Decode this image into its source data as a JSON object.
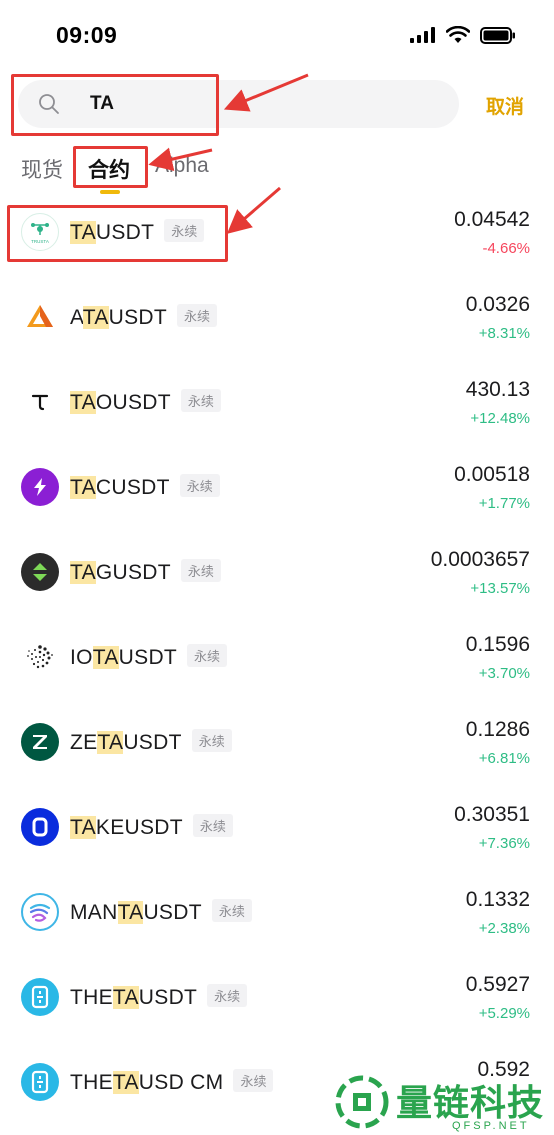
{
  "status_bar": {
    "time": "09:09"
  },
  "search": {
    "value": "TA",
    "cancel_label": "取消"
  },
  "tabs": [
    {
      "label": "现货",
      "active": false
    },
    {
      "label": "合约",
      "active": true
    },
    {
      "label": "Alpha",
      "active": false
    }
  ],
  "badge_label": "永续",
  "rows": [
    {
      "prefix": "",
      "highlight": "TA",
      "suffix": "USDT",
      "price": "0.04542",
      "change": "-4.66%",
      "direction": "down",
      "icon": "trusta-logo-icon"
    },
    {
      "prefix": "A",
      "highlight": "TA",
      "suffix": "USDT",
      "price": "0.0326",
      "change": "+8.31%",
      "direction": "up",
      "icon": "automata-logo-icon"
    },
    {
      "prefix": "",
      "highlight": "TA",
      "suffix": "OUSDT",
      "price": "430.13",
      "change": "+12.48%",
      "direction": "up",
      "icon": "bittensor-logo-icon"
    },
    {
      "prefix": "",
      "highlight": "TA",
      "suffix": "CUSDT",
      "price": "0.00518",
      "change": "+1.77%",
      "direction": "up",
      "icon": "tac-logo-icon"
    },
    {
      "prefix": "",
      "highlight": "TA",
      "suffix": "GUSDT",
      "price": "0.0003657",
      "change": "+13.57%",
      "direction": "up",
      "icon": "tagger-logo-icon"
    },
    {
      "prefix": "IO",
      "highlight": "TA",
      "suffix": "USDT",
      "price": "0.1596",
      "change": "+3.70%",
      "direction": "up",
      "icon": "iota-logo-icon"
    },
    {
      "prefix": "ZE",
      "highlight": "TA",
      "suffix": "USDT",
      "price": "0.1286",
      "change": "+6.81%",
      "direction": "up",
      "icon": "zetachain-logo-icon"
    },
    {
      "prefix": "",
      "highlight": "TA",
      "suffix": "KEUSDT",
      "price": "0.30351",
      "change": "+7.36%",
      "direction": "up",
      "icon": "take-logo-icon"
    },
    {
      "prefix": "MAN",
      "highlight": "TA",
      "suffix": "USDT",
      "price": "0.1332",
      "change": "+2.38%",
      "direction": "up",
      "icon": "manta-logo-icon"
    },
    {
      "prefix": "THE",
      "highlight": "TA",
      "suffix": "USDT",
      "price": "0.5927",
      "change": "+5.29%",
      "direction": "up",
      "icon": "theta-logo-icon"
    },
    {
      "prefix": "THE",
      "highlight": "TA",
      "suffix": "USD CM",
      "price": "0.592",
      "change": "",
      "direction": "up",
      "icon": "theta-logo-icon"
    }
  ],
  "watermark": {
    "text": "量链科技",
    "sub": "QFSP.NET"
  },
  "colors": {
    "accent": "#f0b90b",
    "cancel": "#e1a300",
    "up": "#2ebd85",
    "down": "#f6465d",
    "highlight": "#fbe6a3",
    "annotation": "#e53935"
  }
}
